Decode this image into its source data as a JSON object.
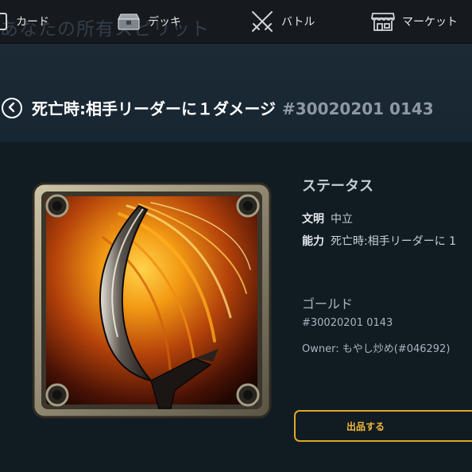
{
  "nav": {
    "ghost_title": "あなたの所有スピリット",
    "items": [
      {
        "label": "カード",
        "icon": "cards-icon"
      },
      {
        "label": "デッキ",
        "icon": "chest-icon"
      },
      {
        "label": "バトル",
        "icon": "crossed-swords-icon"
      },
      {
        "label": "マーケット",
        "icon": "shop-icon"
      }
    ]
  },
  "card": {
    "title": "死亡時:相手リーダーに１ダメージ",
    "id": "#30020201 0143"
  },
  "status": {
    "heading": "ステータス",
    "attribute_key": "文明",
    "attribute_value": "中立",
    "ability_key": "能力",
    "ability_value": "死亡時:相手リーダーに 1",
    "rarity": "ゴールド",
    "serial": "#30020201 0143",
    "owner": "Owner: もやし炒め(#046292)"
  },
  "actions": {
    "sell_label": "出品する"
  },
  "colors": {
    "accent": "#e0a72a",
    "title_band": "#1c2a36",
    "background": "#111b22"
  }
}
